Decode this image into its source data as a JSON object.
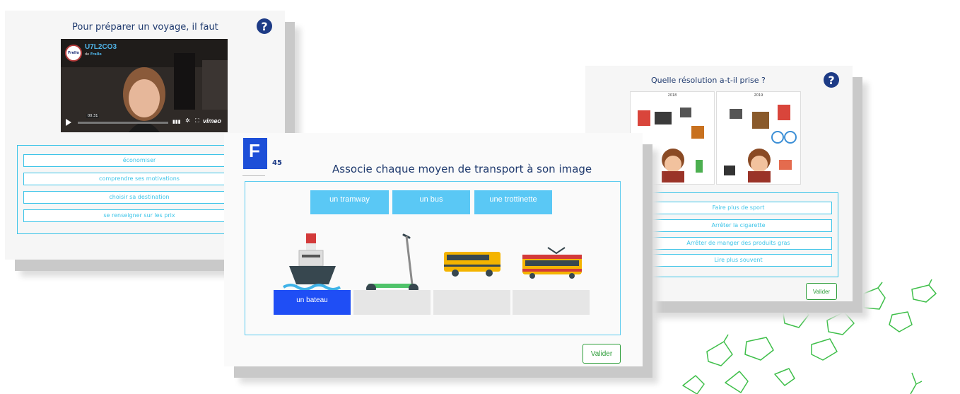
{
  "card_left": {
    "title": "Pour préparer un voyage, il faut",
    "help": "?",
    "video": {
      "code": "U7L2CO3",
      "author_prefix": "de",
      "author": "Frello",
      "logo_text": "Frello",
      "time": "00:31",
      "brand": "vimeo"
    },
    "options": [
      "économiser",
      "comprendre ses motivations",
      "choisir sa destination",
      "se renseigner sur les prix"
    ]
  },
  "card_right": {
    "title": "Quelle résolution a-t-il prise ?",
    "help": "?",
    "image_labels": [
      "2018",
      "2019"
    ],
    "options": [
      "Faire plus de sport",
      "Arrêter la cigarette",
      "Arrêter de manger des produits gras",
      "Lire plus souvent"
    ],
    "validate_label": "Valider"
  },
  "card_center": {
    "logo_letter": "F",
    "counter": "45",
    "title": "Associe chaque moyen de transport à son image",
    "chips": [
      "un tramway",
      "un bus",
      "une trottinette"
    ],
    "slots": [
      "un bateau",
      "",
      "",
      ""
    ],
    "validate_label": "Valider",
    "icons": [
      "ship-icon",
      "scooter-icon",
      "bus-icon",
      "tram-icon"
    ]
  },
  "colors": {
    "accent_blue": "#3cc4e8",
    "chip_blue": "#5ac8f5",
    "slot_filled": "#1f4ef5",
    "validate_green": "#2e9e3a",
    "title_navy": "#1f3a6e",
    "leaf_green": "#3fbf4a"
  }
}
